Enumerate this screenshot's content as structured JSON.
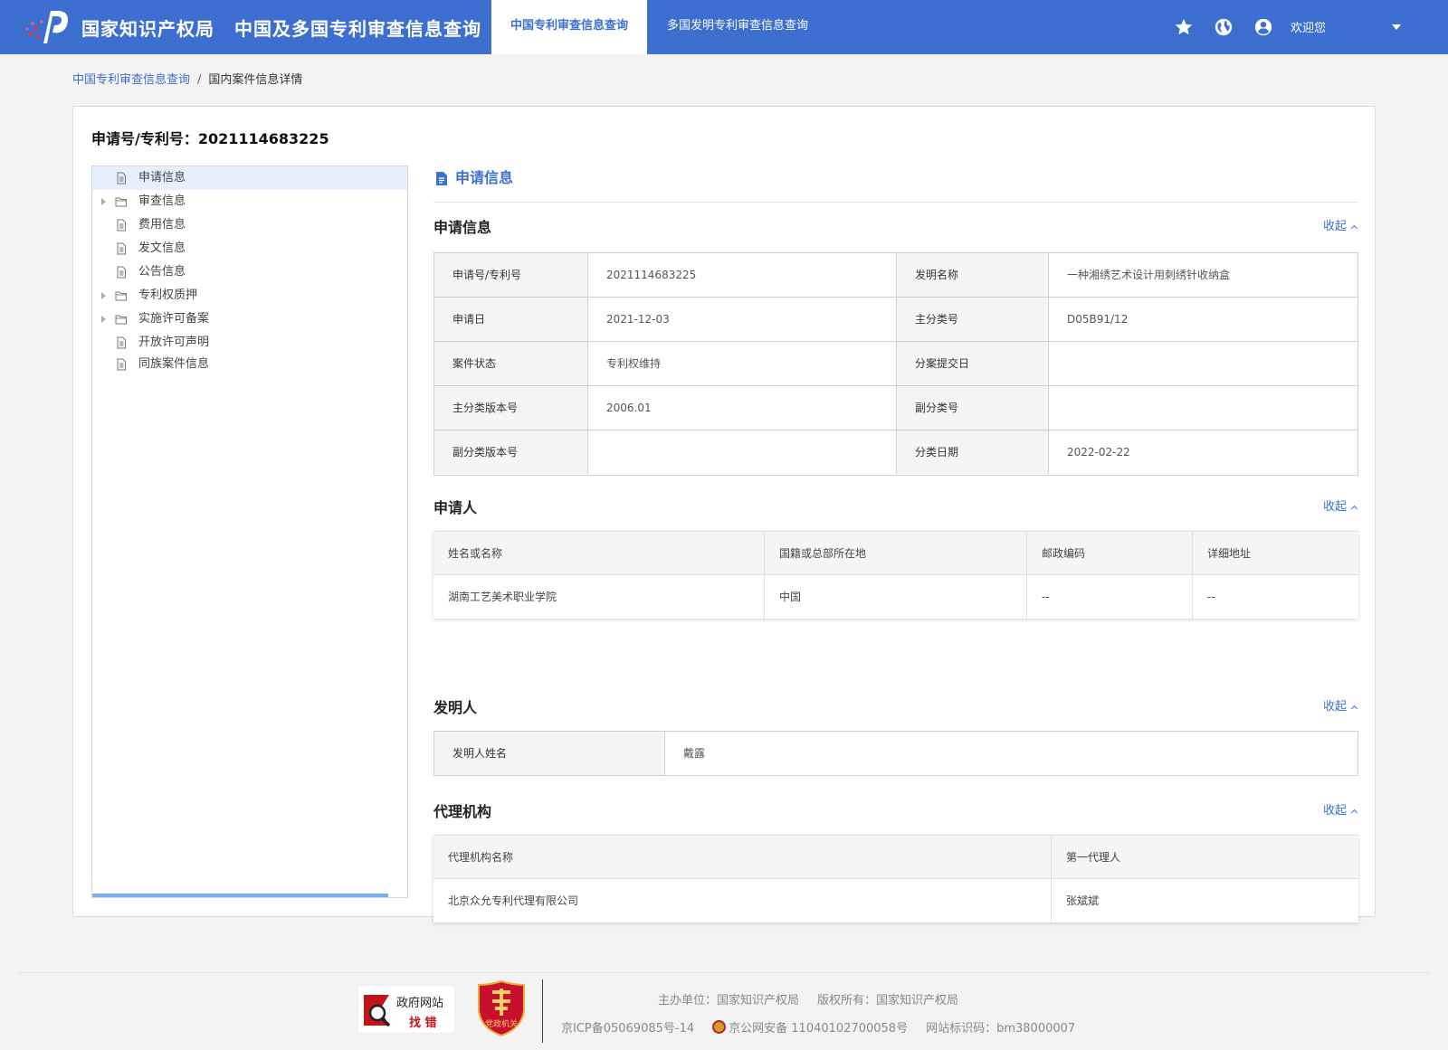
{
  "header": {
    "org": "国家知识产权局",
    "system": "中国及多国专利审查信息查询",
    "tabs": [
      {
        "label": "中国专利审查信息查询",
        "active": true
      },
      {
        "label": "多国发明专利审查信息查询",
        "active": false
      }
    ],
    "icons": [
      "star-icon",
      "globe-icon",
      "user-icon"
    ],
    "welcome": "欢迎您",
    "brand_color": "#3d6fd1"
  },
  "breadcrumb": {
    "link": "中国专利审查信息查询",
    "separator": "/",
    "current": "国内案件信息详情"
  },
  "application_number": "申请号/专利号：2021114683225",
  "tree": [
    {
      "label": "申请信息",
      "icon": "document-icon",
      "expandable": false,
      "selected": true
    },
    {
      "label": "审查信息",
      "icon": "folder-icon",
      "expandable": true,
      "selected": false
    },
    {
      "label": "费用信息",
      "icon": "document-icon",
      "expandable": false,
      "selected": false
    },
    {
      "label": "发文信息",
      "icon": "document-icon",
      "expandable": false,
      "selected": false
    },
    {
      "label": "公告信息",
      "icon": "document-icon",
      "expandable": false,
      "selected": false
    },
    {
      "label": "专利权质押",
      "icon": "folder-icon",
      "expandable": true,
      "selected": false
    },
    {
      "label": "实施许可备案",
      "icon": "folder-icon",
      "expandable": true,
      "selected": false
    },
    {
      "label": "开放许可声明",
      "icon": "document-icon",
      "expandable": false,
      "selected": false
    },
    {
      "label": "同族案件信息",
      "icon": "document-icon",
      "expandable": false,
      "selected": false
    }
  ],
  "panel_title": "申请信息",
  "collapse_label": "收起",
  "application_info": {
    "title": "申请信息",
    "rows": [
      [
        {
          "label": "申请号/专利号",
          "value": "2021114683225"
        },
        {
          "label": "发明名称",
          "value": "一种湘绣艺术设计用刺绣针收纳盒"
        }
      ],
      [
        {
          "label": "申请日",
          "value": "2021-12-03"
        },
        {
          "label": "主分类号",
          "value": "D05B91/12"
        }
      ],
      [
        {
          "label": "案件状态",
          "value": "专利权维持"
        },
        {
          "label": "分案提交日",
          "value": ""
        }
      ],
      [
        {
          "label": "主分类版本号",
          "value": "2006.01"
        },
        {
          "label": "副分类号",
          "value": ""
        }
      ],
      [
        {
          "label": "副分类版本号",
          "value": ""
        },
        {
          "label": "分类日期",
          "value": "2022-02-22"
        }
      ]
    ]
  },
  "applicant": {
    "title": "申请人",
    "columns": [
      "姓名或名称",
      "国籍或总部所在地",
      "邮政编码",
      "详细地址"
    ],
    "rows": [
      [
        "湖南工艺美术职业学院",
        "中国",
        "--",
        "--"
      ]
    ]
  },
  "inventor": {
    "title": "发明人",
    "label": "发明人姓名",
    "value": "戴露"
  },
  "agency": {
    "title": "代理机构",
    "columns": [
      "代理机构名称",
      "第一代理人"
    ],
    "rows": [
      [
        "北京众允专利代理有限公司",
        "张斌斌"
      ]
    ]
  },
  "footer": {
    "gov_badge_line1": "政府网站",
    "gov_badge_line2": "找 错",
    "party_badge": "党政机关",
    "host": "主办单位：国家知识产权局",
    "copyright": "版权所有：国家知识产权局",
    "icp": "京ICP备05069085号-14",
    "police": "京公网安备 11040102700058号",
    "site_code": "网站标识码：bm38000007"
  }
}
